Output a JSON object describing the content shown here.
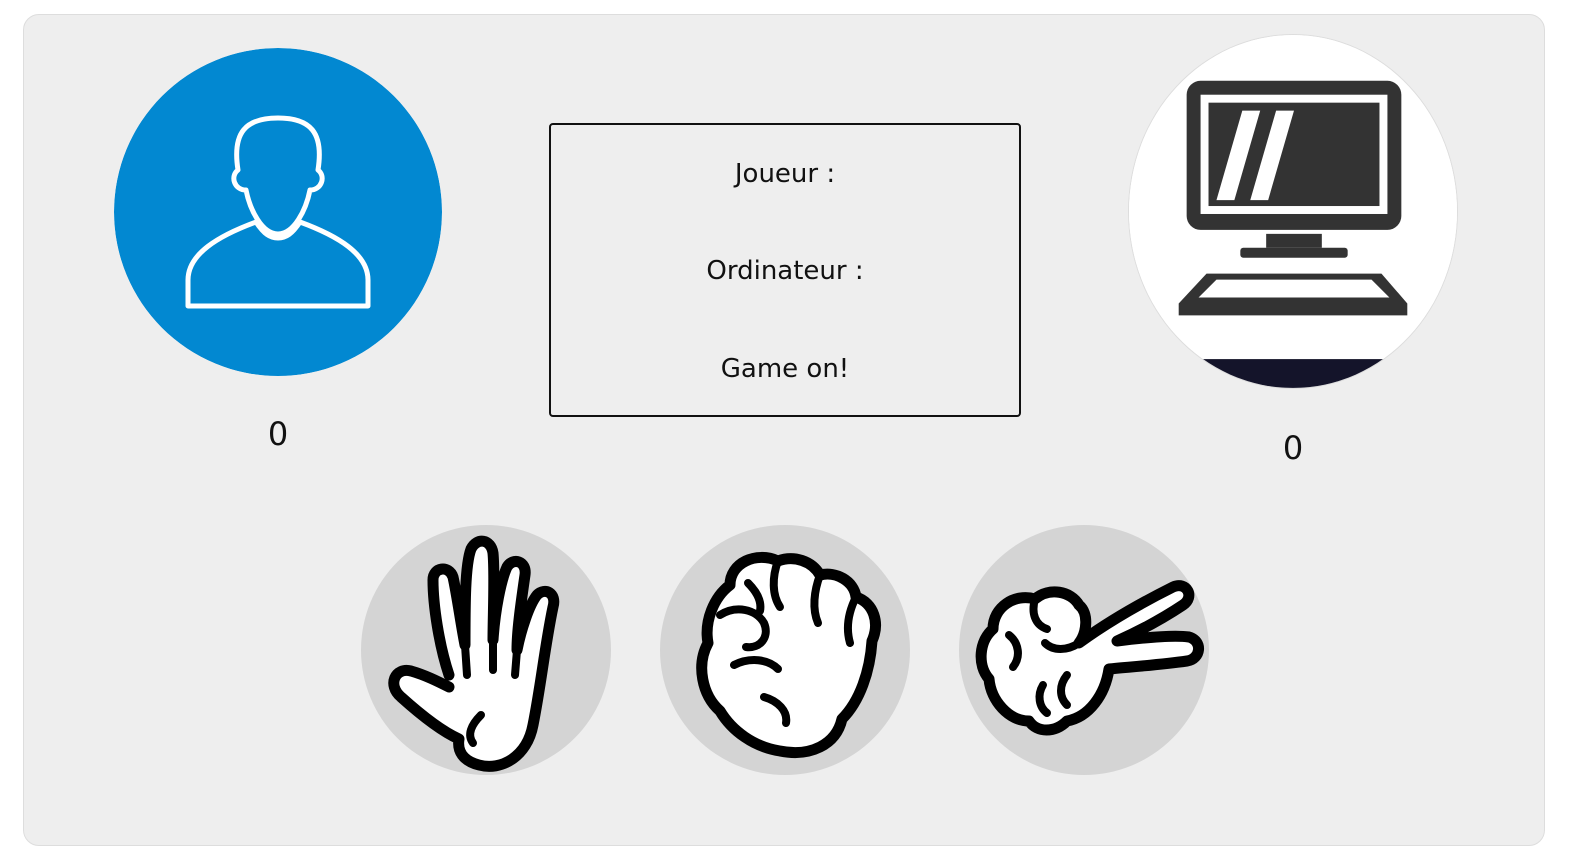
{
  "scoreboard": {
    "player_score": "0",
    "computer_score": "0"
  },
  "status": {
    "player_label": "Joueur :",
    "computer_label": "Ordinateur :",
    "result": "Game on!"
  },
  "choices": [
    {
      "name": "paper",
      "icon": "open-hand-icon"
    },
    {
      "name": "rock",
      "icon": "fist-icon"
    },
    {
      "name": "scissors",
      "icon": "victory-hand-icon"
    }
  ],
  "colors": {
    "player_avatar_bg": "#0288d1",
    "choice_bg": "#d4d4d4",
    "card_bg": "#eeeeee",
    "monitor_dark": "#333333"
  }
}
